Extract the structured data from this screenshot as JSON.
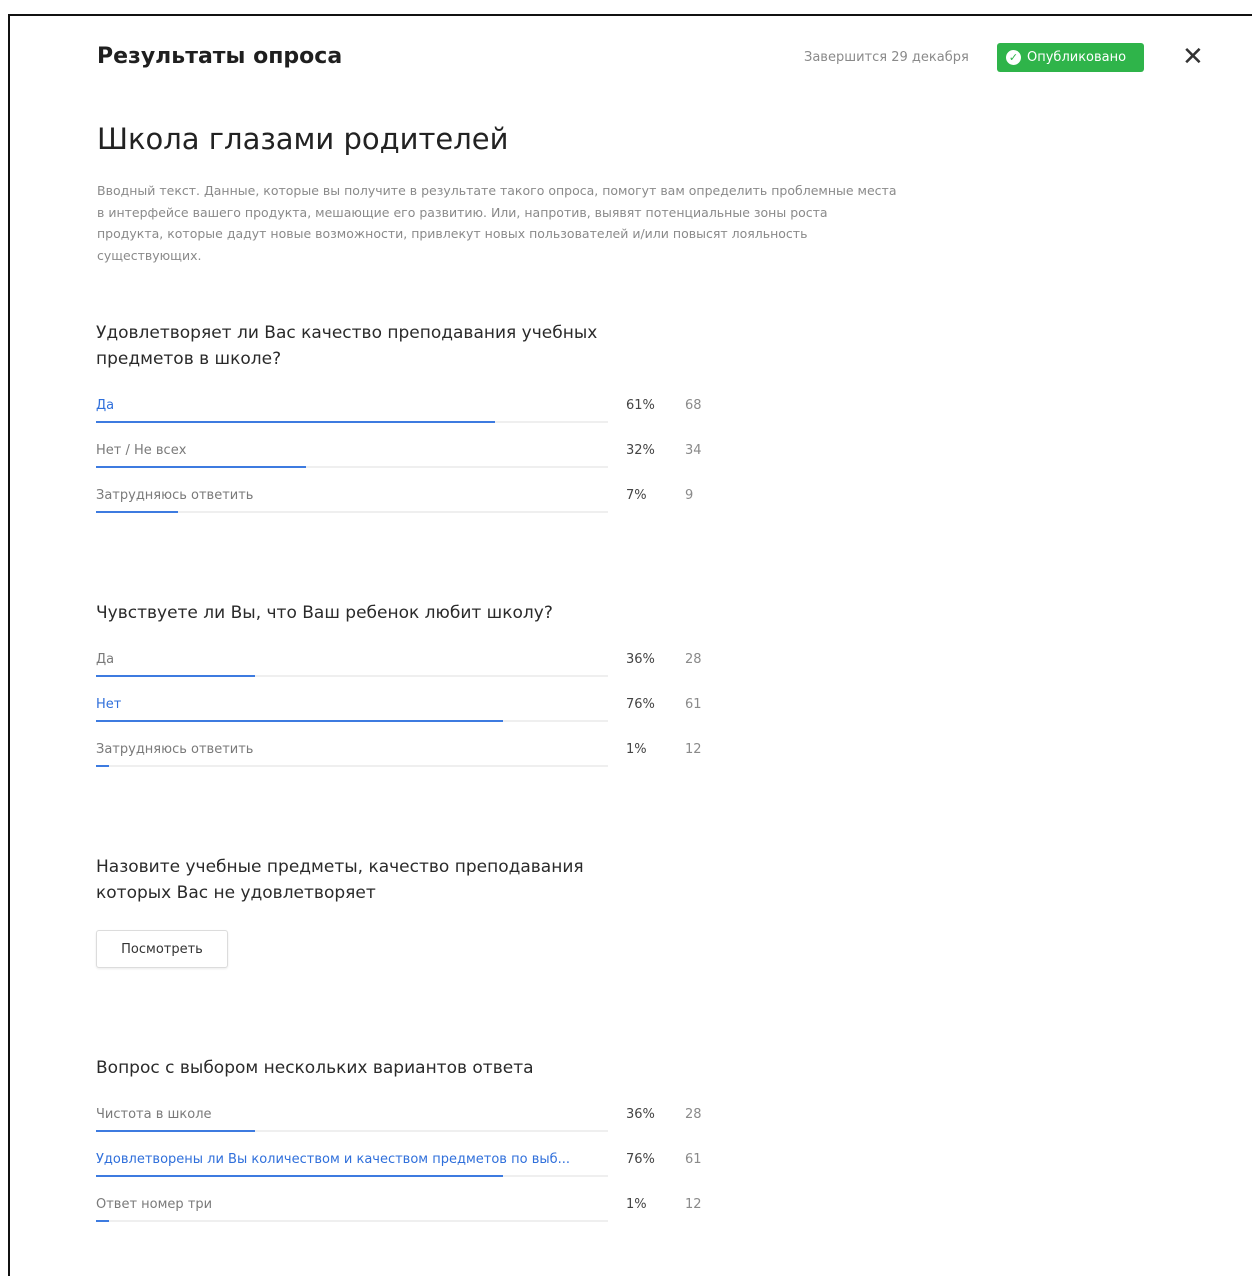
{
  "header": {
    "title": "Результаты опроса",
    "deadline": "Завершится 29 декабря",
    "status_badge": "Опубликовано",
    "close_icon": "close-icon"
  },
  "survey": {
    "title": "Школа глазами родителей",
    "intro": "Вводный текст. Данные, которые вы получите в результате такого опроса, помогут вам определить проблемные места в интерфейсе вашего продукта, мешающие его развитию. Или, напротив, выявят потенциальные зоны роста продукта, которые дадут новые возможности, привлекут новых пользователей и/или повысят лояльность существующих."
  },
  "questions": [
    {
      "title": "Удовлетворяет ли Вас качество преподавания учебных предметов в школе?",
      "options": [
        {
          "label": "Да",
          "percent": "61%",
          "count": "68",
          "fill": 0.78,
          "selected": true
        },
        {
          "label": "Нет / Не всех",
          "percent": "32%",
          "count": "34",
          "fill": 0.41,
          "selected": false
        },
        {
          "label": "Затрудняюсь ответить",
          "percent": "7%",
          "count": "9",
          "fill": 0.16,
          "selected": false
        }
      ]
    },
    {
      "title": "Чувствуете ли Вы, что Ваш ребенок любит школу?",
      "options": [
        {
          "label": "Да",
          "percent": "36%",
          "count": "28",
          "fill": 0.31,
          "selected": false
        },
        {
          "label": "Нет",
          "percent": "76%",
          "count": "61",
          "fill": 0.795,
          "selected": true
        },
        {
          "label": "Затрудняюсь ответить",
          "percent": "1%",
          "count": "12",
          "fill": 0.025,
          "selected": false
        }
      ]
    },
    {
      "title": "Назовите учебные предметы, качество преподавания которых Вас не удовлетворяет",
      "button": "Посмотреть"
    },
    {
      "title": "Вопрос с выбором нескольких вариантов ответа",
      "options": [
        {
          "label": "Чистота в школе",
          "percent": "36%",
          "count": "28",
          "fill": 0.31,
          "selected": false
        },
        {
          "label": "Удовлетворены ли Вы количеством и качеством предметов по выб...",
          "percent": "76%",
          "count": "61",
          "fill": 0.795,
          "selected": true
        },
        {
          "label": "Ответ номер три",
          "percent": "1%",
          "count": "12",
          "fill": 0.025,
          "selected": false
        }
      ]
    }
  ],
  "colors": {
    "accent": "#3d7be0",
    "selected_text": "#2f6fdb",
    "badge_green": "#2fb44a"
  }
}
